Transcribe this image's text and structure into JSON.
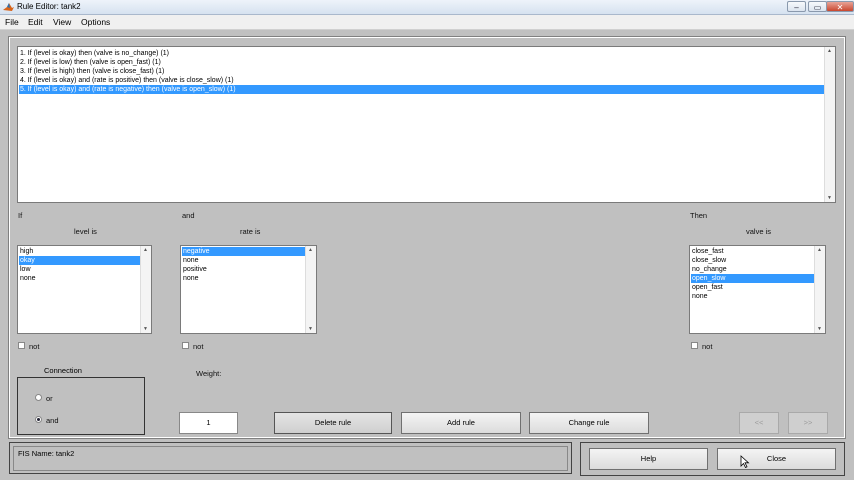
{
  "window": {
    "title": "Rule Editor: tank2",
    "minimize": "–",
    "maximize": "▭",
    "close": "✕"
  },
  "menu": [
    "File",
    "Edit",
    "View",
    "Options"
  ],
  "rules": [
    "1. If (level is okay) then (valve is no_change) (1)",
    "2. If (level is low) then (valve is open_fast) (1)",
    "3. If (level is high) then (valve is close_fast) (1)",
    "4. If (level is okay) and (rate is positive) then (valve is close_slow) (1)",
    "5. If (level is okay) and (rate is negative) then (valve is open_slow) (1)"
  ],
  "selected_rule": 4,
  "if_label": "If",
  "and_label": "and",
  "then_label": "Then",
  "level": {
    "label": "level is",
    "options": [
      "high",
      "okay",
      "low",
      "none"
    ],
    "selected": 1
  },
  "rate": {
    "label": "rate is",
    "options": [
      "negative",
      "none",
      "positive",
      "none"
    ],
    "selected": 0
  },
  "valve": {
    "label": "valve is",
    "options": [
      "close_fast",
      "close_slow",
      "no_change",
      "open_slow",
      "open_fast",
      "none"
    ],
    "selected": 3
  },
  "not_label": "not",
  "connection": {
    "title": "Connection",
    "or": "or",
    "and": "and",
    "selected": "and"
  },
  "weight": {
    "label": "Weight:",
    "value": "1"
  },
  "buttons": {
    "delete": "Delete rule",
    "add": "Add rule",
    "change": "Change rule",
    "prev": "<<",
    "next": ">>",
    "help": "Help",
    "close": "Close"
  },
  "status": "FIS Name: tank2",
  "colors": {
    "selection": "#3399ff",
    "background": "#c0c0c0"
  }
}
